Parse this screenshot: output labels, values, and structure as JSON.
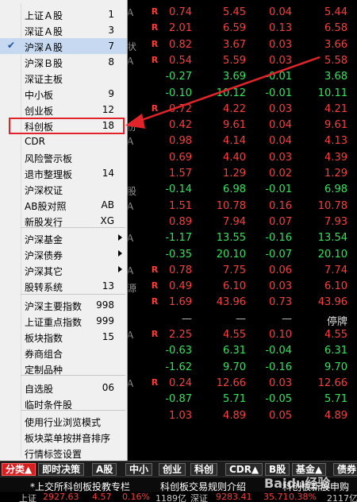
{
  "menu": {
    "items": [
      {
        "label": "上证Ａ股",
        "shortcut": "1"
      },
      {
        "label": "深证Ａ股",
        "shortcut": "3"
      },
      {
        "label": "沪深Ａ股",
        "shortcut": "7",
        "checked": true
      },
      {
        "label": "沪深Ｂ股",
        "shortcut": "8"
      },
      {
        "label": "深证主板",
        "shortcut": ""
      },
      {
        "label": "中小板",
        "shortcut": "9"
      },
      {
        "label": "创业板",
        "shortcut": "12"
      },
      {
        "label": "科创板",
        "shortcut": "18",
        "highlighted": true
      },
      {
        "label": "CDR",
        "shortcut": ""
      },
      {
        "label": "风险警示板",
        "shortcut": ""
      },
      {
        "label": "退市整理板",
        "shortcut": "14"
      },
      {
        "label": "沪深权证",
        "shortcut": ""
      },
      {
        "label": "AB股对照",
        "shortcut": "AB"
      },
      {
        "label": "新股发行",
        "shortcut": "XG"
      },
      {
        "label": "沪深基金",
        "submenu": true
      },
      {
        "label": "沪深债券",
        "submenu": true
      },
      {
        "label": "沪深其它",
        "submenu": true
      },
      {
        "label": "股转系统",
        "shortcut": "13"
      },
      {
        "label": "沪深主要指数",
        "shortcut": "998"
      },
      {
        "label": "上证重点指数",
        "shortcut": "999"
      },
      {
        "label": "板块指数",
        "shortcut": "15"
      },
      {
        "label": "券商组合",
        "shortcut": ""
      },
      {
        "label": "定制品种",
        "shortcut": ""
      },
      {
        "label": "自选股",
        "shortcut": "06"
      },
      {
        "label": "临时条件股",
        "shortcut": ""
      },
      {
        "label": "使用行业浏览模式",
        "shortcut": ""
      },
      {
        "label": "板块菜单按拼音排序",
        "shortcut": ""
      },
      {
        "label": "行情标签设置",
        "shortcut": ""
      }
    ],
    "check_mark": "✔"
  },
  "grid": {
    "rows": [
      {
        "frag": "A",
        "r": true,
        "v": [
          "0.74",
          "5.45",
          "0.04",
          "5.44"
        ],
        "c": [
          "red",
          "red",
          "red",
          "red"
        ]
      },
      {
        "frag": "",
        "r": true,
        "v": [
          "2.01",
          "6.59",
          "0.13",
          "6.58"
        ],
        "c": [
          "red",
          "red",
          "red",
          "red"
        ]
      },
      {
        "frag": "状",
        "r": true,
        "v": [
          "0.82",
          "3.67",
          "0.03",
          "3.66"
        ],
        "c": [
          "red",
          "red",
          "red",
          "red"
        ]
      },
      {
        "frag": "A",
        "r": true,
        "v": [
          "0.54",
          "5.59",
          "0.03",
          "5.58"
        ],
        "c": [
          "red",
          "red",
          "red",
          "red"
        ]
      },
      {
        "frag": "",
        "r": false,
        "v": [
          "-0.27",
          "3.69",
          "-0.01",
          "3.68"
        ],
        "c": [
          "green",
          "green",
          "green",
          "green"
        ]
      },
      {
        "frag": "",
        "r": false,
        "v": [
          "-0.10",
          "10.12",
          "-0.01",
          "10.11"
        ],
        "c": [
          "green",
          "green",
          "green",
          "green"
        ]
      },
      {
        "frag": "",
        "r": true,
        "v": [
          "0.72",
          "4.22",
          "0.03",
          "4.21"
        ],
        "c": [
          "red",
          "red",
          "red",
          "red"
        ]
      },
      {
        "frag": "份",
        "r": false,
        "v": [
          "0.42",
          "9.61",
          "0.04",
          "9.61"
        ],
        "c": [
          "red",
          "red",
          "red",
          "red"
        ]
      },
      {
        "frag": "A",
        "r": false,
        "v": [
          "0.98",
          "4.14",
          "0.04",
          "4.13"
        ],
        "c": [
          "red",
          "red",
          "red",
          "red"
        ]
      },
      {
        "frag": "",
        "r": false,
        "v": [
          "0.69",
          "4.40",
          "0.03",
          "4.39"
        ],
        "c": [
          "red",
          "red",
          "red",
          "red"
        ]
      },
      {
        "frag": "",
        "r": false,
        "v": [
          "1.57",
          "1.29",
          "0.02",
          "1.29"
        ],
        "c": [
          "red",
          "red",
          "red",
          "red"
        ]
      },
      {
        "frag": "股",
        "r": false,
        "v": [
          "-0.14",
          "6.98",
          "-0.01",
          "6.98"
        ],
        "c": [
          "green",
          "green",
          "green",
          "green"
        ]
      },
      {
        "frag": "A",
        "r": false,
        "v": [
          "1.51",
          "10.78",
          "0.16",
          "10.78"
        ],
        "c": [
          "red",
          "red",
          "red",
          "red"
        ]
      },
      {
        "frag": "",
        "r": false,
        "v": [
          "0.89",
          "7.94",
          "0.07",
          "7.93"
        ],
        "c": [
          "red",
          "red",
          "red",
          "red"
        ]
      },
      {
        "frag": "A",
        "r": false,
        "v": [
          "-1.17",
          "13.55",
          "-0.16",
          "13.54"
        ],
        "c": [
          "green",
          "green",
          "green",
          "green"
        ]
      },
      {
        "frag": "",
        "r": false,
        "v": [
          "-0.35",
          "20.10",
          "-0.07",
          "20.10"
        ],
        "c": [
          "green",
          "green",
          "green",
          "green"
        ]
      },
      {
        "frag": "A",
        "r": true,
        "v": [
          "0.78",
          "7.75",
          "0.06",
          "7.74"
        ],
        "c": [
          "red",
          "red",
          "red",
          "red"
        ]
      },
      {
        "frag": "源",
        "r": true,
        "v": [
          "0.49",
          "6.10",
          "0.03",
          "6.10"
        ],
        "c": [
          "red",
          "red",
          "red",
          "red"
        ]
      },
      {
        "frag": "",
        "r": true,
        "v": [
          "1.69",
          "43.96",
          "0.73",
          "43.96"
        ],
        "c": [
          "red",
          "red",
          "red",
          "red"
        ]
      },
      {
        "frag": "",
        "r": false,
        "v": [
          "—",
          "—",
          "—",
          "停牌"
        ],
        "c": [
          "gray",
          "gray",
          "gray",
          "white"
        ]
      },
      {
        "frag": "A",
        "r": true,
        "v": [
          "2.25",
          "4.55",
          "0.10",
          "4.55"
        ],
        "c": [
          "red",
          "red",
          "red",
          "red"
        ]
      },
      {
        "frag": "",
        "r": false,
        "v": [
          "-0.63",
          "6.31",
          "-0.04",
          "6.31"
        ],
        "c": [
          "green",
          "green",
          "green",
          "green"
        ]
      },
      {
        "frag": "",
        "r": false,
        "v": [
          "-1.62",
          "9.70",
          "-0.16",
          "9.70"
        ],
        "c": [
          "green",
          "green",
          "green",
          "green"
        ]
      },
      {
        "frag": "A",
        "r": true,
        "v": [
          "0.24",
          "12.66",
          "0.03",
          "12.66"
        ],
        "c": [
          "red",
          "red",
          "red",
          "red"
        ]
      },
      {
        "frag": "",
        "r": false,
        "v": [
          "-0.87",
          "5.71",
          "-0.05",
          "5.71"
        ],
        "c": [
          "green",
          "green",
          "green",
          "green"
        ]
      },
      {
        "frag": "",
        "r": false,
        "v": [
          "1.03",
          "4.89",
          "0.05",
          "4.89"
        ],
        "c": [
          "red",
          "red",
          "red",
          "red"
        ]
      }
    ],
    "r_mark": "R"
  },
  "tabs": [
    {
      "label": "分类▲",
      "active": true
    },
    {
      "label": "即时决策"
    },
    {
      "label": "A股"
    },
    {
      "label": "中小"
    },
    {
      "label": "创业"
    },
    {
      "label": "科创"
    },
    {
      "label": "CDR▲"
    },
    {
      "label": "B股"
    },
    {
      "label": "基金▲"
    },
    {
      "label": "债券"
    }
  ],
  "ticker": {
    "item1": "*上交所科创板投教专栏",
    "item2": "科创板交易规则介绍",
    "item3": "科创板新股申购"
  },
  "status": {
    "index1_name": "上证",
    "index1_value": "2927.63",
    "index1_change": "4.57",
    "index1_pct": "0.16%",
    "index1_volume": "1189亿",
    "index2_name": "深证",
    "index2_value": "9283.41",
    "index2_change": "35.71",
    "index2_pct": "0.38%",
    "index2_volume": "2117亿"
  },
  "watermark": "Baidu经验",
  "colors": {
    "highlight": "#e2242a",
    "up": "#ff3c3c",
    "down": "#2ee65a",
    "menu_bg": "#f0f0f0"
  }
}
